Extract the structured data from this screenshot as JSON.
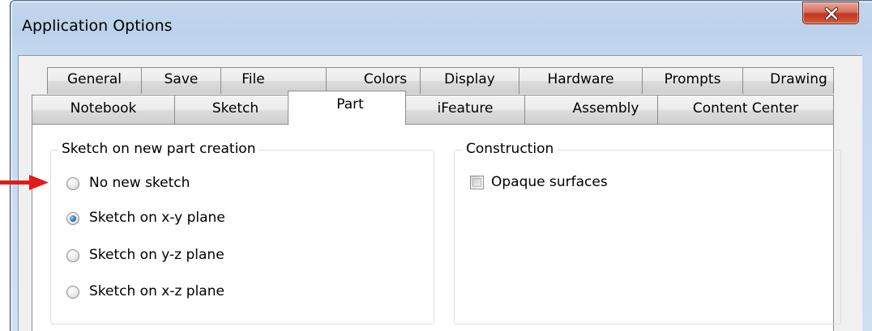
{
  "window": {
    "title": "Application Options"
  },
  "tabs_row1": [
    {
      "label": "General"
    },
    {
      "label": "Save"
    },
    {
      "label": "File"
    },
    {
      "label": "Colors"
    },
    {
      "label": "Display"
    },
    {
      "label": "Hardware"
    },
    {
      "label": "Prompts"
    },
    {
      "label": "Drawing"
    }
  ],
  "tabs_row2": [
    {
      "label": "Notebook"
    },
    {
      "label": "Sketch"
    },
    {
      "label": "Part",
      "selected": true
    },
    {
      "label": "iFeature"
    },
    {
      "label": "Assembly"
    },
    {
      "label": "Content Center"
    }
  ],
  "sketch_group": {
    "title": "Sketch on new part creation",
    "options": [
      {
        "label": "No new sketch",
        "checked": false
      },
      {
        "label": "Sketch on x-y plane",
        "checked": true
      },
      {
        "label": "Sketch on y-z plane",
        "checked": false
      },
      {
        "label": "Sketch on x-z plane",
        "checked": false
      }
    ]
  },
  "construction_group": {
    "title": "Construction",
    "opaque_surfaces": {
      "label": "Opaque surfaces",
      "checked": false
    }
  },
  "colors": {
    "annotation_arrow": "#e21a1a",
    "close_button": "#c7402a",
    "radio_selected": "#2c6fb3"
  }
}
